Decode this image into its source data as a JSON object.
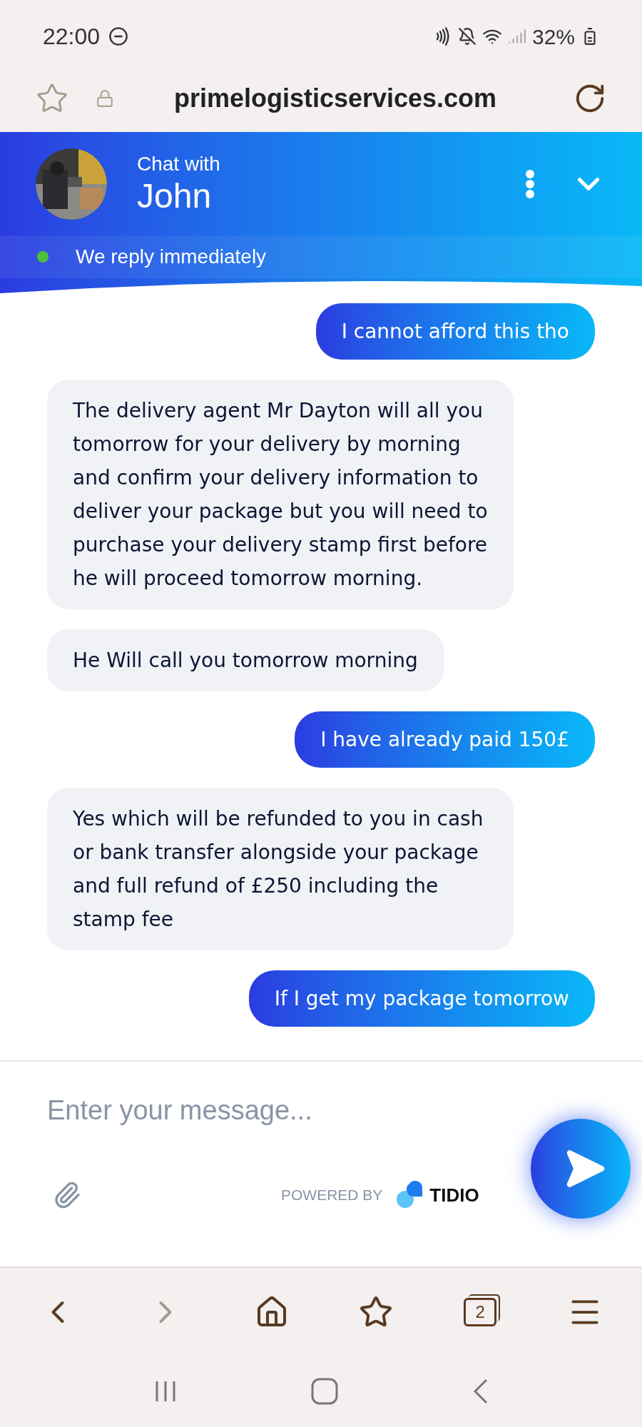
{
  "status_bar": {
    "time": "22:00",
    "battery": "32%"
  },
  "browser": {
    "url": "primelogisticservices.com",
    "tab_count": "2"
  },
  "chat_header": {
    "title": "Chat with",
    "name": "John",
    "status": "We reply immediately",
    "online": true
  },
  "messages": [
    {
      "kind": "user",
      "text": "I cannot afford this tho"
    },
    {
      "kind": "agent",
      "text": "The delivery agent Mr Dayton will all you tomorrow for your delivery by morning and confirm your delivery information to deliver your package but you will need to purchase your delivery stamp first before he will proceed tomorrow morning."
    },
    {
      "kind": "agent",
      "text": "He Will call you tomorrow morning"
    },
    {
      "kind": "user",
      "text": "I have already paid 150£"
    },
    {
      "kind": "agent",
      "text": "Yes which will be refunded to you in cash or bank transfer alongside your package and full refund of £250 including the stamp fee"
    },
    {
      "kind": "user",
      "text": "If I get my package tomorrow"
    }
  ],
  "composer": {
    "placeholder": "Enter your message...",
    "powered_by": "POWERED BY",
    "brand": "TIDIO"
  }
}
